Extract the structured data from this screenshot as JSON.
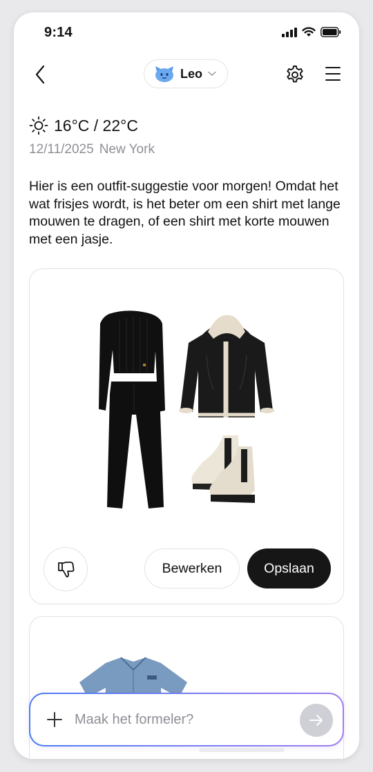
{
  "status_bar": {
    "time": "9:14"
  },
  "header": {
    "agent_name": "Leo"
  },
  "weather": {
    "temperature": "16°C / 22°C",
    "date": "12/11/2025",
    "location": "New York"
  },
  "message": "Hier is een outfit-suggestie voor morgen! Omdat het wat frisjes wordt, is het beter om een shirt met lange mouwen te dragen, of een shirt met korte mouwen met een jasje.",
  "card": {
    "edit_label": "Bewerken",
    "save_label": "Opslaan"
  },
  "composer": {
    "placeholder": "Maak het formeler?"
  },
  "colors": {
    "accent_start": "#4a7df0",
    "accent_end": "#9f7cf2",
    "primary_button": "#161616",
    "send_disabled": "#cfd0d6"
  }
}
